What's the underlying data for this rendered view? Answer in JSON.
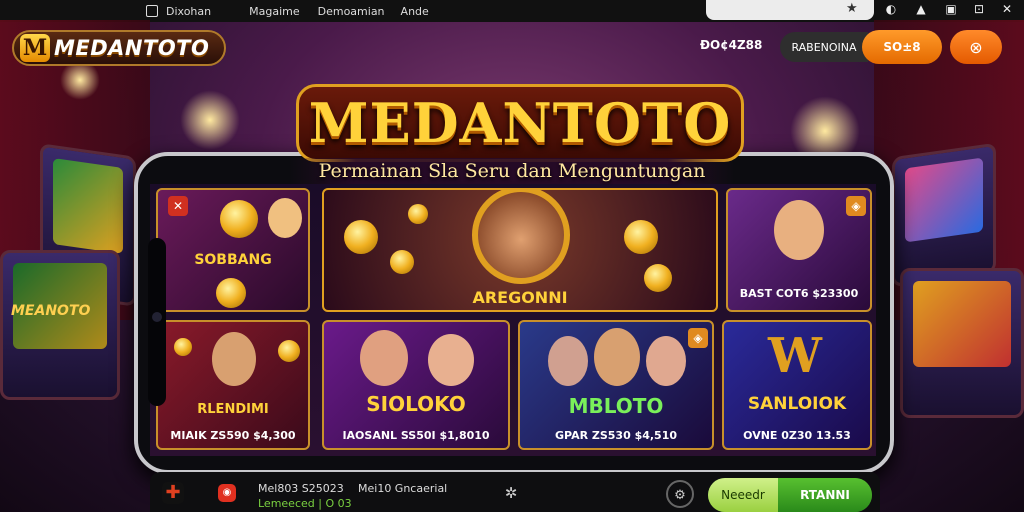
{
  "topbar": {
    "menu": [
      "Dixohan",
      "Magaime",
      "Demoamian",
      "Ande"
    ],
    "urlbar_value": ""
  },
  "header": {
    "logo_mark": "M",
    "logo_text": "MEDANTOTO",
    "balance": "ÐO¢4Z88",
    "grey_button": "RABENOINA",
    "orange_button": "SO±8",
    "close_icon": "x-icon"
  },
  "hero": {
    "title": "MEDANTOTO",
    "subtitle": "Permainan Sla Seru dan Menguntungan"
  },
  "tiles": [
    {
      "label": "SOBBANG",
      "price": ""
    },
    {
      "label": "AREGONNI",
      "price": ""
    },
    {
      "label": "",
      "price": "BAST COT6 $23300"
    },
    {
      "label": "RLENDIMI",
      "price": "MIAIK ZS590 $4,300"
    },
    {
      "label": "SIOLOKO",
      "price": "IAOSANL SS50I $1,8010"
    },
    {
      "label": "MBLOTO",
      "price": "GPAR ZS530 $4,510"
    },
    {
      "label": "SANLOIOK",
      "price": "OVNE 0Z30 13.53"
    }
  ],
  "cabinets": {
    "left_label": "MEANOTO"
  },
  "bottombar": {
    "line1": "Mel803 S25023",
    "line1b": "Mei10 Gncaerial",
    "line2": "Lemeeced | O 03",
    "pill_left": "Neeedr",
    "pill_right": "RTANNI"
  },
  "colors": {
    "accent": "#e46a00",
    "gold": "#ffd23a",
    "green": "#3a8a2a"
  }
}
